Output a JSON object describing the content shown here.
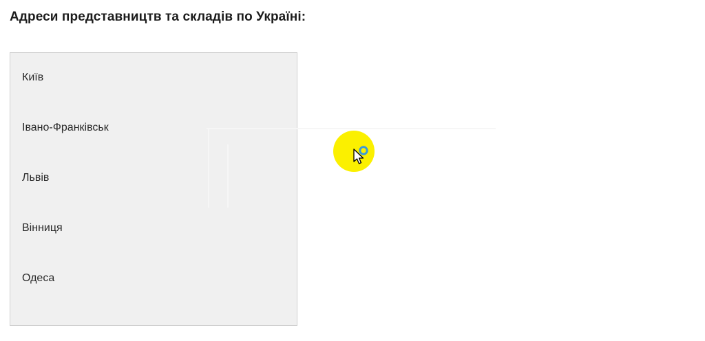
{
  "heading": "Адреси представництв та складів по Україні:",
  "cities": [
    {
      "label": "Київ"
    },
    {
      "label": "Івано-Франківськ"
    },
    {
      "label": "Львів"
    },
    {
      "label": "Вінниця"
    },
    {
      "label": "Одеса"
    }
  ],
  "colors": {
    "panel_background": "#f0f0f0",
    "cursor_highlight": "#fbf000",
    "cursor_ring": "#3a9ad9"
  },
  "icons": {
    "cursor": "mouse-pointer-icon",
    "busy_indicator": "loading-ring-icon"
  }
}
